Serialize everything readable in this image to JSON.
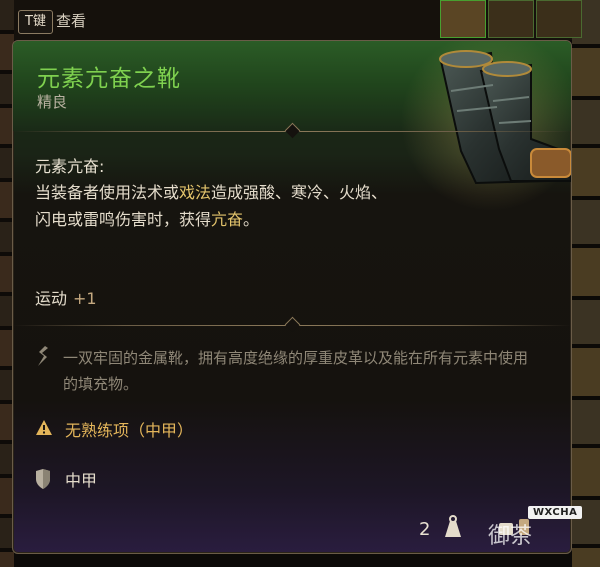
{
  "hotkey": {
    "key": "T键",
    "label": "查看"
  },
  "item": {
    "name": "元素亢奋之靴",
    "rarity": "精良",
    "ability_name": "元素亢奋:",
    "ability_desc_1": "当装备者使用法术或",
    "ability_desc_hl1": "戏法",
    "ability_desc_2": "造成强酸、寒冷、火焰、闪电或雷鸣伤害时，获得",
    "ability_desc_hl2": "亢奋",
    "ability_desc_3": "。",
    "stat_name": "运动",
    "stat_value": "+1",
    "flavor": "一双牢固的金属靴，拥有高度绝缘的厚重皮革以及能在所有元素中使用的填充物。",
    "proficiency_warning": "无熟练项（中甲）",
    "armor_type": "中甲",
    "price": "2"
  },
  "watermark": {
    "badge": "WXCHA",
    "text": "御茶"
  },
  "colors": {
    "title_green": "#7fd14f",
    "highlight_gold": "#e3c46c",
    "warning_orange": "#e3b55a",
    "header_green": "#2b5c26"
  },
  "icons": [
    "boots-icon",
    "flavor-icon",
    "warning-icon",
    "shield-icon",
    "weight-icon",
    "coin-icon"
  ]
}
